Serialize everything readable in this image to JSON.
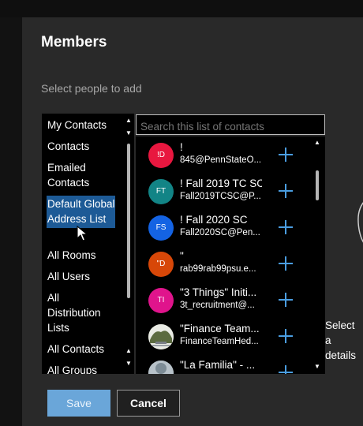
{
  "dialog": {
    "title": "Members",
    "subtitle": "Select people to add"
  },
  "sources": [
    {
      "label": "My Contacts"
    },
    {
      "label": "Contacts"
    },
    {
      "label": "Emailed Contacts"
    },
    {
      "label": "Default Global Address List",
      "selected": true
    },
    {
      "label": "All Rooms"
    },
    {
      "label": "All Users"
    },
    {
      "label": "All Distribution Lists"
    },
    {
      "label": "All Contacts"
    },
    {
      "label": "All Groups"
    }
  ],
  "search": {
    "placeholder": "Search this list of contacts"
  },
  "contacts": [
    {
      "initials": "!D",
      "name": "!",
      "email": "845@PennStateO...",
      "color": "#e8173f"
    },
    {
      "initials": "FT",
      "name": "! Fall 2019 TC SC",
      "email": "Fall2019TCSC@P...",
      "color": "#128486"
    },
    {
      "initials": "FS",
      "name": "! Fall 2020 SC",
      "email": "Fall2020SC@Pen...",
      "color": "#1463e3"
    },
    {
      "initials": "\"D",
      "name": "\"",
      "email": "rab99rab99psu.e...",
      "color": "#d74708"
    },
    {
      "initials": "TI",
      "name": "\"3 Things\" Initi...",
      "email": "3t_recruitment@...",
      "color": "#e0148c"
    },
    {
      "initials": "",
      "name": "\"Finance Team...",
      "email": "FinanceTeamHed...",
      "color": "#6d7a5a"
    },
    {
      "initials": "",
      "name": "\"La Familia\" - ...",
      "email": "",
      "color": "#8a9aa6"
    }
  ],
  "details_hint": "Select a details",
  "actions": {
    "save": "Save",
    "cancel": "Cancel"
  },
  "colors": {
    "accent": "#4a9de0",
    "selection": "#1d5a96",
    "dialog_bg": "#292929"
  }
}
